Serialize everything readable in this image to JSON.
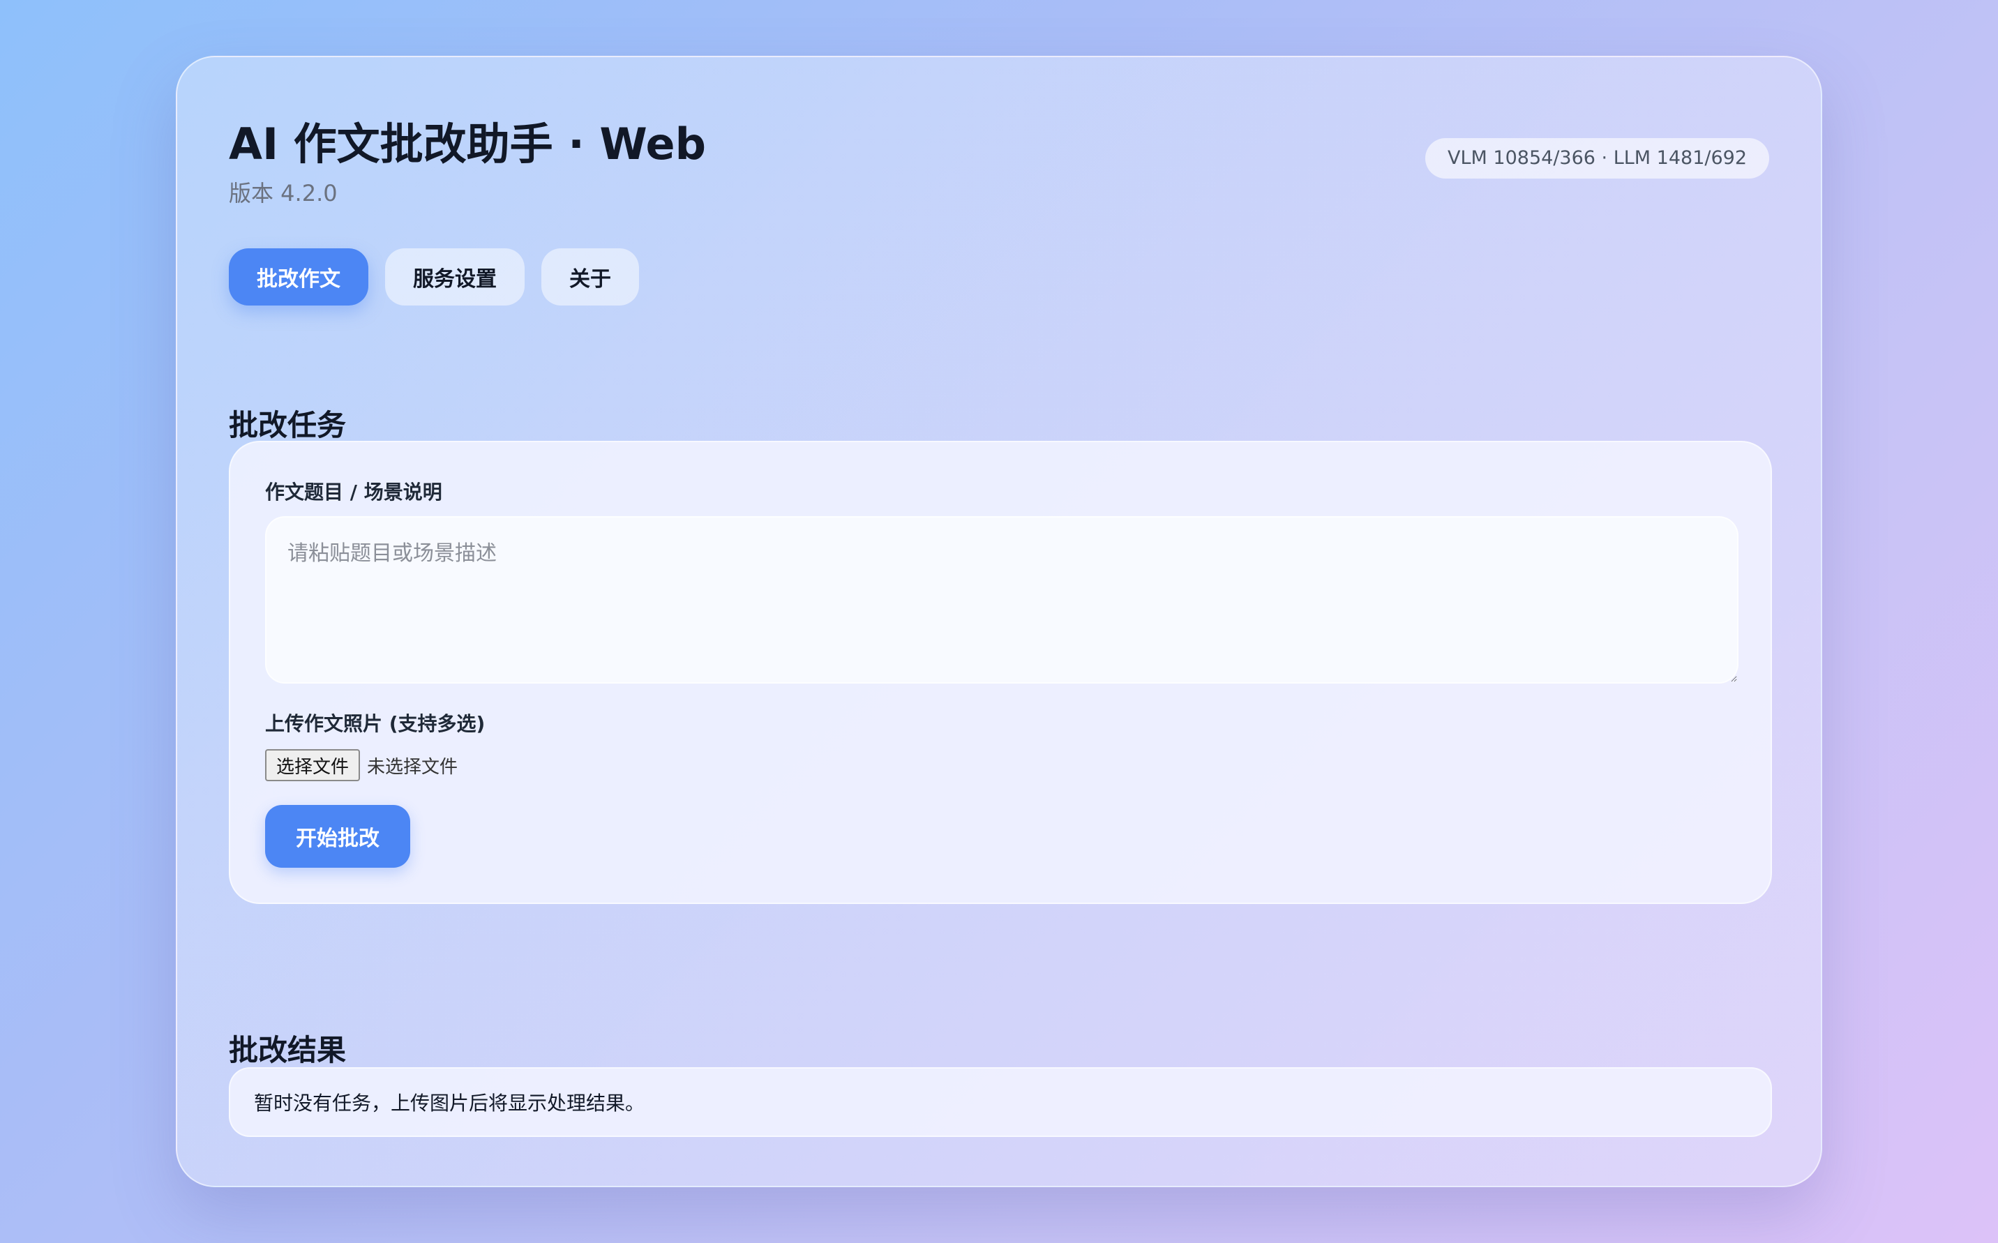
{
  "header": {
    "title": "AI 作文批改助手 · Web",
    "version": "版本 4.2.0",
    "usage": "VLM 10854/366 · LLM 1481/692"
  },
  "tabs": [
    {
      "label": "批改作文",
      "active": true
    },
    {
      "label": "服务设置",
      "active": false
    },
    {
      "label": "关于",
      "active": false
    }
  ],
  "task_section": {
    "title": "批改任务",
    "topic_label": "作文题目 / 场景说明",
    "topic_placeholder": "请粘贴题目或场景描述",
    "topic_value": "",
    "upload_label": "上传作文照片 (支持多选)",
    "file_button": "选择文件",
    "file_status": "未选择文件",
    "start_button": "开始批改"
  },
  "result_section": {
    "title": "批改结果",
    "empty_message": "暂时没有任务，上传图片后将显示处理结果。"
  },
  "colors": {
    "accent": "#4c86f4",
    "text_primary": "#111827",
    "text_muted": "#6b7280"
  }
}
